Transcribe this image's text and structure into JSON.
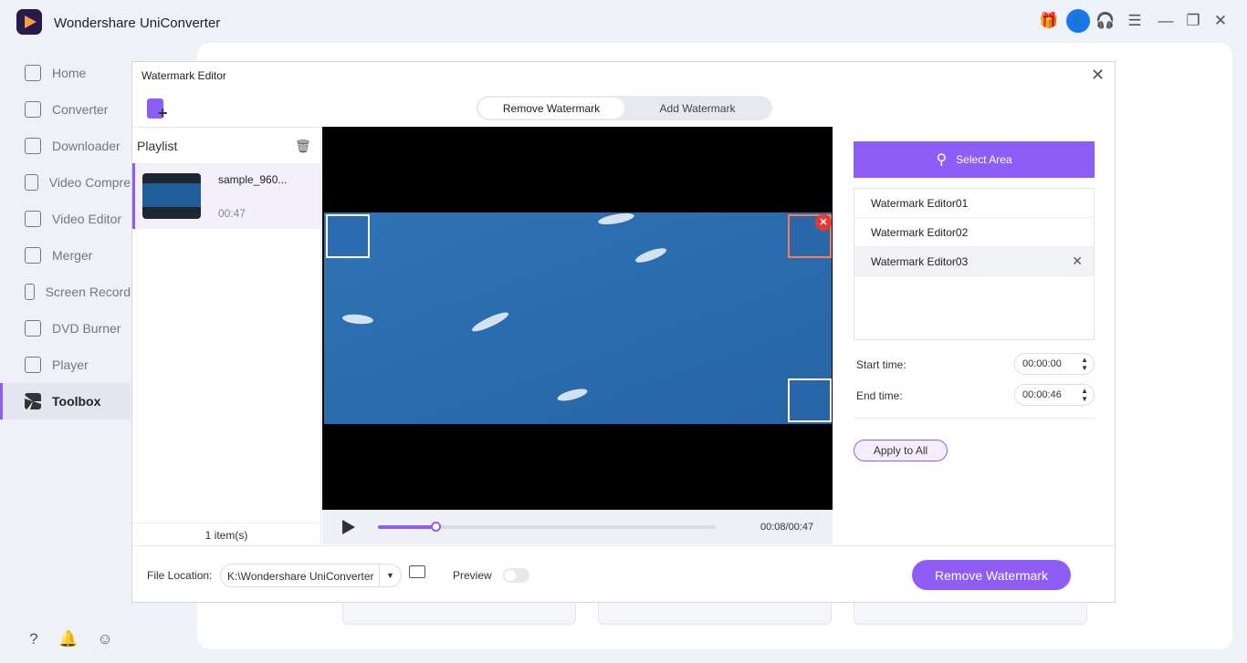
{
  "app": {
    "title": "Wondershare UniConverter"
  },
  "window_controls": [
    "gift-icon",
    "account-icon",
    "support-icon",
    "menu-icon",
    "minimize-icon",
    "restore-icon",
    "close-icon"
  ],
  "sidebar": {
    "items": [
      {
        "label": "Home",
        "icon": "home-icon"
      },
      {
        "label": "Converter",
        "icon": "converter-icon"
      },
      {
        "label": "Downloader",
        "icon": "download-icon"
      },
      {
        "label": "Video Compre",
        "icon": "compress-icon"
      },
      {
        "label": "Video Editor",
        "icon": "scissors-icon"
      },
      {
        "label": "Merger",
        "icon": "merge-icon"
      },
      {
        "label": "Screen Record",
        "icon": "record-icon"
      },
      {
        "label": "DVD Burner",
        "icon": "disc-icon"
      },
      {
        "label": "Player",
        "icon": "player-icon"
      },
      {
        "label": "Toolbox",
        "icon": "toolbox-icon",
        "active": true
      }
    ]
  },
  "dialog": {
    "title": "Watermark Editor",
    "tabs": [
      {
        "label": "Remove Watermark",
        "active": true
      },
      {
        "label": "Add Watermark"
      }
    ],
    "playlist": {
      "title": "Playlist",
      "items": [
        {
          "name": "sample_960...",
          "duration": "00:47"
        }
      ],
      "count": "1 item(s)"
    },
    "player": {
      "time": "00:08/00:47",
      "progress": 0.17
    },
    "select_area": "Select Area",
    "watermarks": [
      "Watermark Editor01",
      "Watermark Editor02",
      "Watermark Editor03"
    ],
    "start_label": "Start time:",
    "start_value": "00:00:00",
    "end_label": "End time:",
    "end_value": "00:00:46",
    "apply_all": "Apply to All",
    "file_location_label": "File Location:",
    "file_location": "K:\\Wondershare UniConverter",
    "preview_label": "Preview",
    "preview_on": false,
    "remove_button": "Remove Watermark"
  },
  "colors": {
    "accent": "#8e5cf7",
    "close_badge": "#e53935"
  }
}
